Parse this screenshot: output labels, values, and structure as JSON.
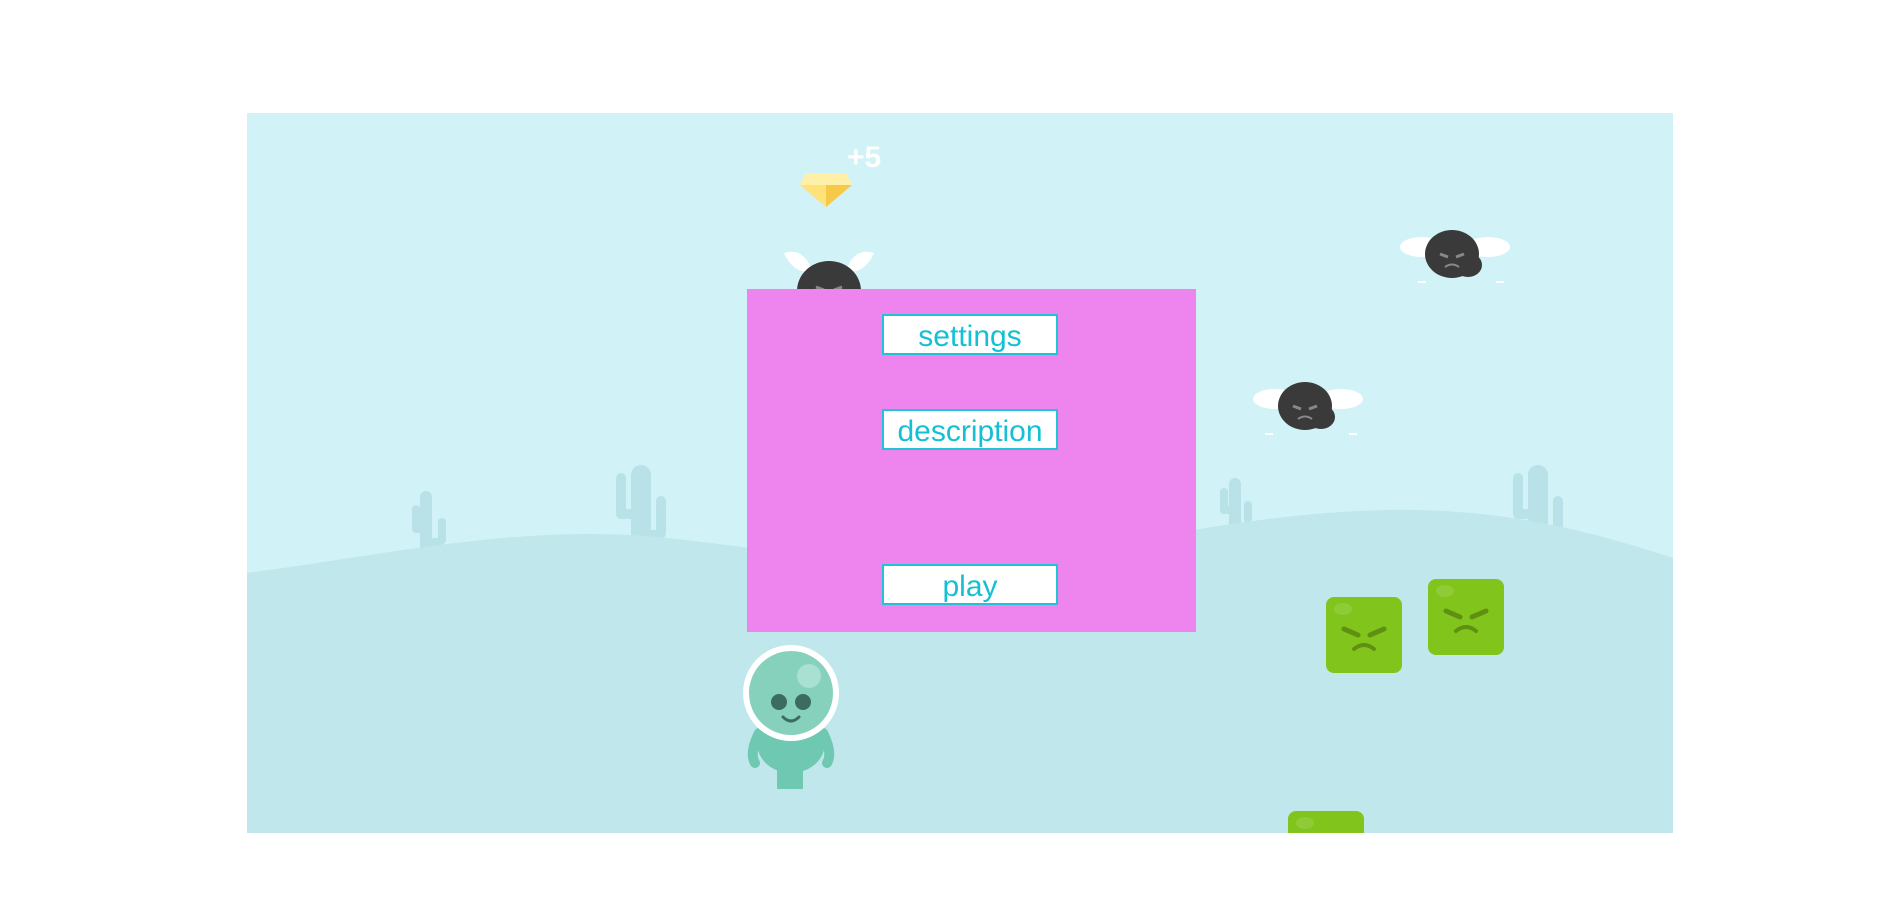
{
  "scene": {
    "gem_bonus": "+5",
    "enemies": [
      {
        "kind": "fly",
        "icon": "fly-enemy-icon"
      },
      {
        "kind": "fly",
        "icon": "fly-enemy-icon"
      },
      {
        "kind": "fly",
        "icon": "fly-enemy-icon"
      },
      {
        "kind": "slime-block",
        "icon": "slime-block-icon"
      },
      {
        "kind": "slime-block",
        "icon": "slime-block-icon"
      },
      {
        "kind": "slime-block",
        "icon": "slime-block-icon"
      }
    ],
    "player_icon": "alien-astronaut-icon",
    "colors": {
      "sky": "#d1f2f6",
      "ground": "#c0e7eb",
      "menu_bg": "#ee84ee",
      "button_text": "#14c0d4",
      "button_border": "#1ec5d6",
      "slime": "#80c41c"
    }
  },
  "menu": {
    "settings_label": "settings",
    "description_label": "description",
    "play_label": "play"
  }
}
